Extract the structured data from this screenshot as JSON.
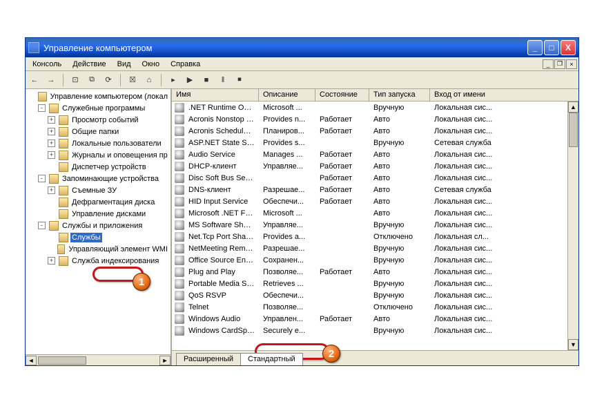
{
  "window": {
    "title": "Управление компьютером",
    "min": "_",
    "max": "□",
    "close": "X"
  },
  "menu": [
    "Консоль",
    "Действие",
    "Вид",
    "Окно",
    "Справка"
  ],
  "mdi": {
    "min": "_",
    "restore": "❐",
    "close": "×"
  },
  "toolbar_icons": [
    "←",
    "→",
    "⊡",
    "⧉",
    "⟳",
    "☒",
    "⌂",
    "▸",
    "▶",
    "■",
    "‖",
    "⏹"
  ],
  "tree": {
    "root": "Управление компьютером (локал",
    "g1": {
      "label": "Служебные программы",
      "exp": "-",
      "items": [
        {
          "label": "Просмотр событий",
          "exp": "+"
        },
        {
          "label": "Общие папки",
          "exp": "+"
        },
        {
          "label": "Локальные пользователи",
          "exp": "+"
        },
        {
          "label": "Журналы и оповещения пр",
          "exp": "+"
        },
        {
          "label": "Диспетчер устройств",
          "exp": ""
        }
      ]
    },
    "g2": {
      "label": "Запоминающие устройства",
      "exp": "-",
      "items": [
        {
          "label": "Съемные ЗУ",
          "exp": "+"
        },
        {
          "label": "Дефрагментация диска",
          "exp": ""
        },
        {
          "label": "Управление дисками",
          "exp": ""
        }
      ]
    },
    "g3": {
      "label": "Службы и приложения",
      "exp": "-",
      "items": [
        {
          "label": "Службы",
          "exp": "",
          "sel": true
        },
        {
          "label": "Управляющий элемент WMI",
          "exp": ""
        },
        {
          "label": "Служба индексирования",
          "exp": "+"
        }
      ]
    }
  },
  "columns": [
    "Имя",
    "Описание",
    "Состояние",
    "Тип запуска",
    "Вход от имени"
  ],
  "rows": [
    {
      "n": ".NET Runtime Opti...",
      "d": "Microsoft ...",
      "s": "",
      "t": "Вручную",
      "a": "Локальная сис..."
    },
    {
      "n": "Acronis Nonstop Ba...",
      "d": "Provides n...",
      "s": "Работает",
      "t": "Авто",
      "a": "Локальная сис..."
    },
    {
      "n": "Acronis Scheduler2 ...",
      "d": "Планиров...",
      "s": "Работает",
      "t": "Авто",
      "a": "Локальная сис..."
    },
    {
      "n": "ASP.NET State Ser...",
      "d": "Provides s...",
      "s": "",
      "t": "Вручную",
      "a": "Сетевая служба"
    },
    {
      "n": "Audio Service",
      "d": "Manages ...",
      "s": "Работает",
      "t": "Авто",
      "a": "Локальная сис..."
    },
    {
      "n": "DHCP-клиент",
      "d": "Управляе...",
      "s": "Работает",
      "t": "Авто",
      "a": "Локальная сис..."
    },
    {
      "n": "Disc Soft Bus Service",
      "d": "",
      "s": "Работает",
      "t": "Авто",
      "a": "Локальная сис..."
    },
    {
      "n": "DNS-клиент",
      "d": "Разрешае...",
      "s": "Работает",
      "t": "Авто",
      "a": "Сетевая служба"
    },
    {
      "n": "HID Input Service",
      "d": "Обеспечи...",
      "s": "Работает",
      "t": "Авто",
      "a": "Локальная сис..."
    },
    {
      "n": "Microsoft .NET Fra...",
      "d": "Microsoft ...",
      "s": "",
      "t": "Авто",
      "a": "Локальная сис..."
    },
    {
      "n": "MS Software Shado...",
      "d": "Управляе...",
      "s": "",
      "t": "Вручную",
      "a": "Локальная сис..."
    },
    {
      "n": "Net.Tcp Port Sharin...",
      "d": "Provides a...",
      "s": "",
      "t": "Отключено",
      "a": "Локальная сл..."
    },
    {
      "n": "NetMeeting Remot...",
      "d": "Разрешае...",
      "s": "",
      "t": "Вручную",
      "a": "Локальная сис..."
    },
    {
      "n": "Office Source Engine",
      "d": "Сохранен...",
      "s": "",
      "t": "Вручную",
      "a": "Локальная сис..."
    },
    {
      "n": "Plug and Play",
      "d": "Позволяе...",
      "s": "Работает",
      "t": "Авто",
      "a": "Локальная сис..."
    },
    {
      "n": "Portable Media Seri...",
      "d": "Retrieves ...",
      "s": "",
      "t": "Вручную",
      "a": "Локальная сис..."
    },
    {
      "n": "QoS RSVP",
      "d": "Обеспечи...",
      "s": "",
      "t": "Вручную",
      "a": "Локальная сис..."
    },
    {
      "n": "Telnet",
      "d": "Позволяе...",
      "s": "",
      "t": "Отключено",
      "a": "Локальная сис..."
    },
    {
      "n": "Windows Audio",
      "d": "Управлен...",
      "s": "Работает",
      "t": "Авто",
      "a": "Локальная сис..."
    },
    {
      "n": "Windows CardSpace",
      "d": "Securely e...",
      "s": "",
      "t": "Вручную",
      "a": "Локальная сис..."
    }
  ],
  "tabs": {
    "ext": "Расширенный",
    "std": "Стандартный"
  },
  "badges": {
    "one": "1",
    "two": "2"
  }
}
